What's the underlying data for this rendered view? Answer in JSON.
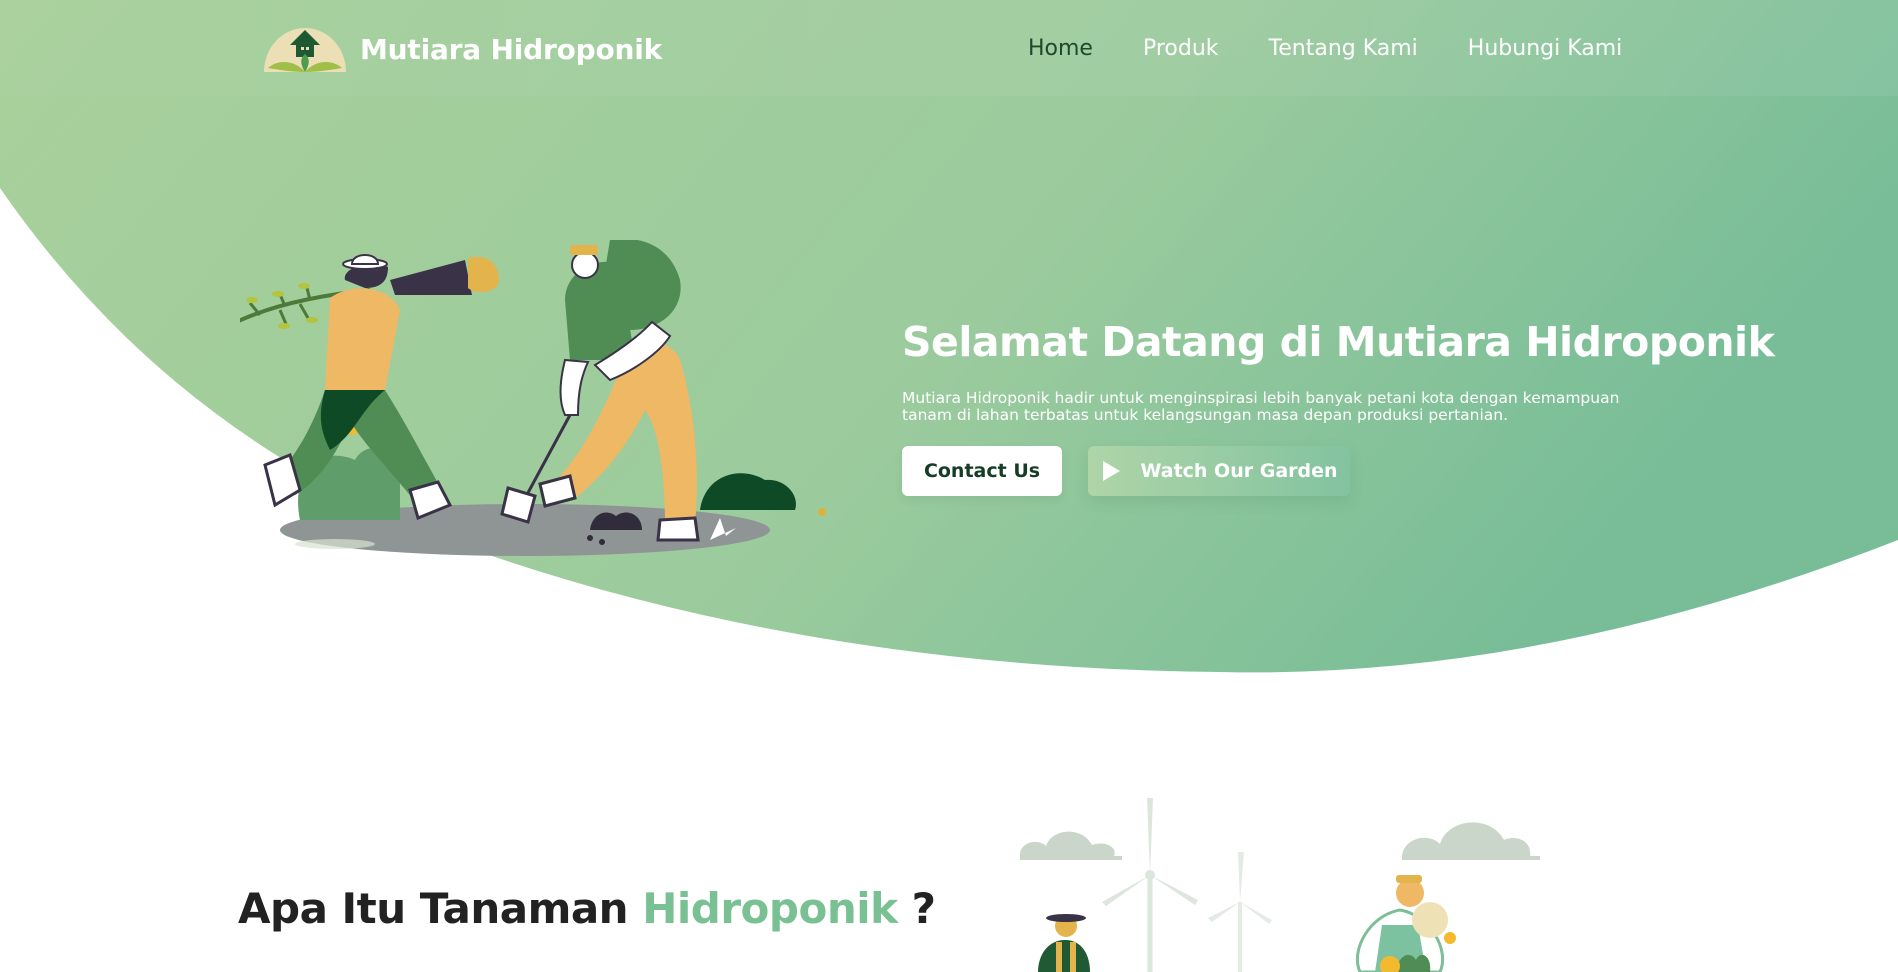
{
  "brand": {
    "name": "Mutiara Hidroponik",
    "logo_icon": "greenhouse-leaf-logo"
  },
  "nav": {
    "items": [
      {
        "label": "Home",
        "active": true
      },
      {
        "label": "Produk",
        "active": false
      },
      {
        "label": "Tentang Kami",
        "active": false
      },
      {
        "label": "Hubungi Kami",
        "active": false
      }
    ]
  },
  "hero": {
    "title": "Selamat Datang di Mutiara Hidroponik",
    "description": "Mutiara Hidroponik hadir untuk menginspirasi lebih banyak petani kota dengan kemampuan tanam di lahan terbatas untuk kelangsungan masa depan produksi pertanian.",
    "contact_button": "Contact Us",
    "watch_button": "Watch Our Garden",
    "watch_icon": "play-icon",
    "illustration": "farmers-planting-illustration"
  },
  "section": {
    "title_prefix": "Apa Itu Tanaman",
    "title_accent": "Hidroponik",
    "title_suffix": "?",
    "illustration": "wind-turbines-farmers-illustration"
  },
  "colors": {
    "hero_green_light": "#a6cf9a",
    "hero_green_dark": "#7cbf97",
    "nav_active": "#1e4a2c",
    "accent": "#79c193",
    "heading_dark": "#222222"
  }
}
